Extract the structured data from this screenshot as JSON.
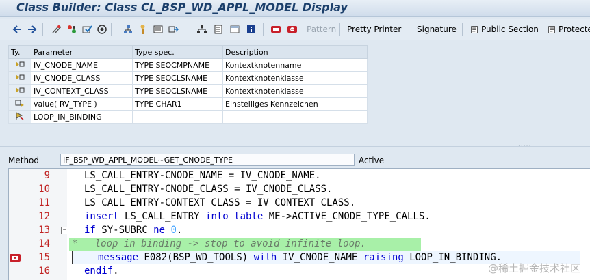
{
  "window": {
    "title": "Class Builder: Class CL_BSP_WD_APPL_MODEL Display"
  },
  "toolbar": {
    "icons": [
      "back-arrow-icon",
      "forward-arrow-icon",
      "other-object-icon",
      "toggle-display-change-icon",
      "check-icon",
      "activate-icon",
      "where-used-icon",
      "hierarchy-icon",
      "display-object-list-icon",
      "enhance-icon",
      "inheritance-icon",
      "navigator-icon",
      "local-types-icon",
      "macros-icon",
      "info-icon",
      "breakpoint-icon",
      "session-breakpoint-icon"
    ],
    "pattern": "Pattern",
    "pretty_printer": "Pretty Printer",
    "signature": "Signature",
    "public_section": "Public Section",
    "protected_section": "Protecte"
  },
  "params": {
    "headers": {
      "ty": "Ty.",
      "parameter": "Parameter",
      "type_spec": "Type spec.",
      "description": "Description"
    },
    "rows": [
      {
        "ty_icon": "importing-param-icon",
        "parameter": "IV_CNODE_NAME",
        "type_spec": "TYPE SEOCMPNAME",
        "description": "Kontextknotenname"
      },
      {
        "ty_icon": "importing-param-icon",
        "parameter": "IV_CNODE_CLASS",
        "type_spec": "TYPE SEOCLSNAME",
        "description": "Kontextknotenklasse"
      },
      {
        "ty_icon": "importing-param-icon",
        "parameter": "IV_CONTEXT_CLASS",
        "type_spec": "TYPE SEOCLSNAME",
        "description": "Kontextknotenklasse"
      },
      {
        "ty_icon": "returning-param-icon",
        "parameter": "value( RV_TYPE )",
        "type_spec": "TYPE CHAR1",
        "description": "Einstelliges Kennzeichen"
      },
      {
        "ty_icon": "exception-icon",
        "parameter": "LOOP_IN_BINDING",
        "type_spec": "",
        "description": ""
      }
    ]
  },
  "method_bar": {
    "label": "Method",
    "value": "IF_BSP_WD_APPL_MODEL~GET_CNODE_TYPE",
    "status": "Active"
  },
  "editor": {
    "lines": [
      {
        "num": "9",
        "parts": [
          "LS_CALL_ENTRY-CNODE_NAME = IV_CNODE_NAME."
        ]
      },
      {
        "num": "10",
        "parts": [
          "LS_CALL_ENTRY-CNODE_CLASS = IV_CNODE_CLASS."
        ]
      },
      {
        "num": "11",
        "parts": [
          "LS_CALL_ENTRY-CONTEXT_CLASS = IV_CONTEXT_CLASS."
        ]
      },
      {
        "num": "12",
        "kw1": "insert",
        "t1": " LS_CALL_ENTRY ",
        "kw2": "into table",
        "t2": " ME->ACTIVE_CNODE_TYPE_CALLS."
      },
      {
        "num": "13",
        "kw1": "if",
        "t1": " SY-SUBRC ",
        "kw2": "ne",
        "n": "0",
        "t2": "."
      },
      {
        "num": "14",
        "comment": "*   loop in binding -> stop to avoid infinite loop."
      },
      {
        "num": "15",
        "kw1": "message",
        "t1": " E082(BSP_WD_TOOLS) ",
        "kw2": "with",
        "t2": " IV_CNODE_NAME ",
        "kw3": "raising",
        "t3": " LOOP_IN_BINDING."
      },
      {
        "num": "16",
        "kw1": "endif",
        "t1": "."
      }
    ]
  },
  "watermark": "@稀土掘金技术社区"
}
